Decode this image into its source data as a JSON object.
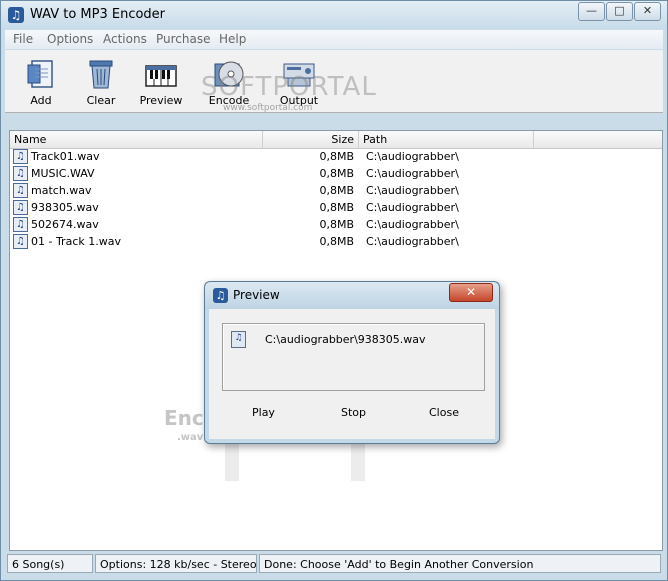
{
  "window": {
    "title": "WAV to MP3 Encoder",
    "min": "—",
    "max": "□",
    "close": "✕"
  },
  "menu": [
    "File",
    "Options",
    "Actions",
    "Purchase",
    "Help"
  ],
  "toolbar": [
    {
      "label": "Add",
      "icon": "add-file-icon"
    },
    {
      "label": "Clear",
      "icon": "recycle-bin-icon"
    },
    {
      "label": "Preview",
      "icon": "piano-keyboard-icon"
    },
    {
      "label": "Encode",
      "icon": "cd-icon"
    },
    {
      "label": "Output",
      "icon": "output-device-icon"
    }
  ],
  "watermark": {
    "text": "SOFTPORTAL",
    "sub": "www.softportal.com"
  },
  "columns": {
    "name": "Name",
    "size": "Size",
    "path": "Path"
  },
  "files": [
    {
      "name": "Track01.wav",
      "size": "0,8MB",
      "path": "C:\\audiograbber\\"
    },
    {
      "name": "MUSIC.WAV",
      "size": "0,8MB",
      "path": "C:\\audiograbber\\"
    },
    {
      "name": "match.wav",
      "size": "0,8MB",
      "path": "C:\\audiograbber\\"
    },
    {
      "name": "938305.wav",
      "size": "0,8MB",
      "path": "C:\\audiograbber\\"
    },
    {
      "name": "502674.wav",
      "size": "0,8MB",
      "path": "C:\\audiograbber\\"
    },
    {
      "name": "01 - Track 1.wav",
      "size": "0,8MB",
      "path": "C:\\audiograbber\\"
    }
  ],
  "background": {
    "text": "Enco",
    "sub": ".wav to"
  },
  "status": {
    "songs": "6 Song(s)",
    "options": "Options: 128 kb/sec - Stereo",
    "message": "Done: Choose 'Add' to Begin Another Conversion"
  },
  "dialog": {
    "title": "Preview",
    "close": "✕",
    "file": "C:\\audiograbber\\938305.wav",
    "play": "Play",
    "stop": "Stop",
    "close_label": "Close"
  },
  "colors": {
    "frame": "#c9dce8",
    "list_bg": "#ffffff",
    "dialog_close": "#c4452b"
  }
}
